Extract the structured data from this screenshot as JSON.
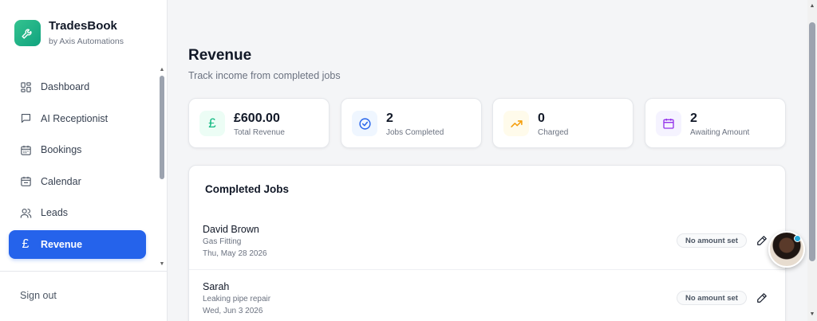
{
  "brand": {
    "name": "TradesBook",
    "subtitle": "by Axis Automations",
    "logo_icon": "wrench-icon",
    "accent": "#10a37f"
  },
  "sidebar": {
    "items": [
      {
        "label": "Dashboard",
        "icon": "dashboard-icon"
      },
      {
        "label": "AI Receptionist",
        "icon": "chat-icon"
      },
      {
        "label": "Bookings",
        "icon": "calendar-grid-icon"
      },
      {
        "label": "Calendar",
        "icon": "calendar-icon"
      },
      {
        "label": "Leads",
        "icon": "users-icon"
      },
      {
        "label": "Revenue",
        "icon": "pound-icon",
        "glyph": "£",
        "active": true
      }
    ],
    "sign_out": "Sign out",
    "active_color": "#2563eb"
  },
  "page": {
    "title": "Revenue",
    "subtitle": "Track income from completed jobs"
  },
  "stats": [
    {
      "value": "£600.00",
      "label": "Total Revenue",
      "icon": "pound-icon",
      "glyph": "£",
      "color": "#10b981",
      "bg": "#ecfdf5"
    },
    {
      "value": "2",
      "label": "Jobs Completed",
      "icon": "check-circle-icon",
      "color": "#2563eb",
      "bg": "#eff6ff"
    },
    {
      "value": "0",
      "label": "Charged",
      "icon": "trending-up-icon",
      "color": "#f59e0b",
      "bg": "#fffbeb"
    },
    {
      "value": "2",
      "label": "Awaiting Amount",
      "icon": "calendar-icon",
      "color": "#9333ea",
      "bg": "#f5f3ff"
    }
  ],
  "jobs": {
    "title": "Completed Jobs",
    "rows": [
      {
        "name": "David Brown",
        "type": "Gas Fitting",
        "date": "Thu, May 28 2026",
        "badge": "No amount set"
      },
      {
        "name": "Sarah",
        "type": "Leaking pipe repair",
        "date": "Wed, Jun 3 2026",
        "badge": "No amount set"
      }
    ]
  }
}
